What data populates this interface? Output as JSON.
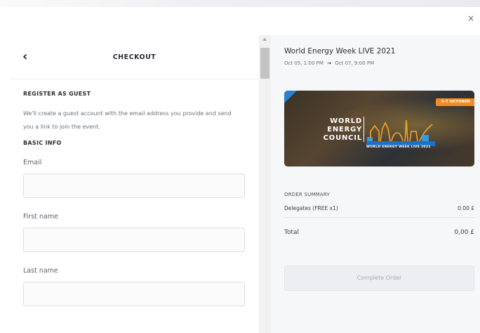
{
  "modal": {
    "close_label": "×"
  },
  "checkout": {
    "back_icon": "chevron-left-icon",
    "title": "CHECKOUT",
    "guest_section_title": "REGISTER AS GUEST",
    "guest_description": "We'll create a guest account with the email address you provide and send you a link to join the event.",
    "basic_info_title": "BASIC INFO",
    "fields": [
      {
        "label": "Email",
        "value": ""
      },
      {
        "label": "First name",
        "value": ""
      },
      {
        "label": "Last name",
        "value": ""
      }
    ]
  },
  "event": {
    "title": "World Energy Week LIVE 2021",
    "start": "Oct 05, 1:00 PM",
    "arrow": "→",
    "end": "Oct 07, 9:00 PM",
    "banner": {
      "tag": "5-7 OCTOBER",
      "logo_lines": [
        "WORLD",
        "ENERGY",
        "COUNCIL"
      ],
      "subtitle": "WORLD ENERGY WEEK LIVE 2021",
      "colors": {
        "tag": "#f58a1f",
        "accent": "#2b7fd1",
        "skyline": "#f5a623"
      }
    }
  },
  "order": {
    "summary_title": "ORDER SUMMARY",
    "items": [
      {
        "label": "Delegates (FREE x1)",
        "amount": "0.00 £"
      }
    ],
    "total_label": "Total",
    "total_amount": "0,00 £",
    "complete_button": "Complete Order"
  }
}
